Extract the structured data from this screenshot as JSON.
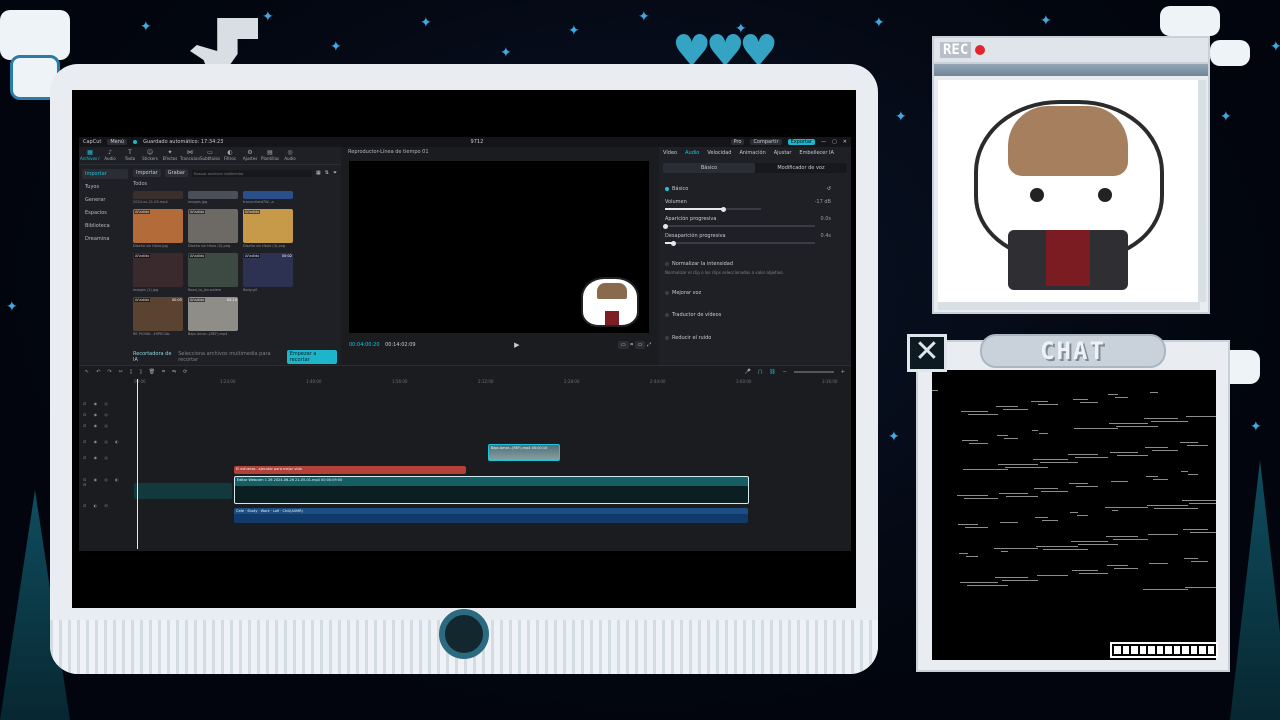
{
  "app": {
    "brand": "CapCut",
    "menu": "Menú",
    "project_name": "Guardado automático: 17:34:23",
    "resolution": "9712",
    "pro_label": "Pro",
    "share_label": "Compartir",
    "export_label": "Exportar"
  },
  "media": {
    "categories": [
      {
        "icon": "▦",
        "label": "Archivos multimedia",
        "icon_name": "media-icon"
      },
      {
        "icon": "♪",
        "label": "Audio",
        "icon_name": "music-icon"
      },
      {
        "icon": "T",
        "label": "Texto",
        "icon_name": "text-icon"
      },
      {
        "icon": "☺",
        "label": "Stickers",
        "icon_name": "sticker-icon"
      },
      {
        "icon": "✦",
        "label": "Efectos",
        "icon_name": "effects-icon"
      },
      {
        "icon": "⋈",
        "label": "Transiciones",
        "icon_name": "transition-icon"
      },
      {
        "icon": "▭",
        "label": "Subtítulos",
        "icon_name": "subtitle-icon"
      },
      {
        "icon": "◐",
        "label": "Filtros",
        "icon_name": "filter-icon"
      },
      {
        "icon": "⚙",
        "label": "Ajustes",
        "icon_name": "adjust-icon"
      },
      {
        "icon": "▤",
        "label": "Plantillas",
        "icon_name": "template-icon"
      },
      {
        "icon": "◎",
        "label": "Audio",
        "icon_name": "audio-ai-icon"
      }
    ],
    "sidebar": [
      "Importar",
      "Tuyos",
      "Generar",
      "Espacios",
      "Biblioteca",
      "Dreamina"
    ],
    "import_label": "Importar",
    "record_label": "Grabar",
    "search_placeholder": "Buscar archivos multimedia",
    "all_label": "Todos",
    "items": [
      {
        "label": "",
        "duration": "",
        "caption": "2024-xx-21-05.mp4",
        "color": "#3b2f2b"
      },
      {
        "label": "",
        "duration": "",
        "caption": "images.jpg",
        "color": "#4a4f58"
      },
      {
        "label": "",
        "duration": "",
        "caption": "transcribed7W...a",
        "color": "#2b4f8a"
      },
      {
        "label": "Añadido",
        "duration": "",
        "caption": "Diseño sin título.jpg",
        "color": "#b36b3a"
      },
      {
        "label": "Añadido",
        "duration": "",
        "caption": "Diseño sin título (2).png",
        "color": "#6d6a66"
      },
      {
        "label": "Añadido",
        "duration": "",
        "caption": "Diseño sin título (3).png",
        "color": "#c79a4a"
      },
      {
        "label": "Añadido",
        "duration": "",
        "caption": "images (1).jpg",
        "color": "#3a2a2e"
      },
      {
        "label": "Añadido",
        "duration": "",
        "caption": "Road_to_Jerusalem",
        "color": "#3d4a43"
      },
      {
        "label": "Añadido",
        "duration": "00:02",
        "caption": "Body.gif",
        "color": "#2d3152"
      },
      {
        "label": "Añadido",
        "duration": "00:05",
        "caption": "RE PICNIK...ESPECIAL",
        "color": "#5a4330"
      },
      {
        "label": "Añadido",
        "duration": "00:10",
        "caption": "Bajo Amor...(REF).mp4",
        "color": "#8f8d88"
      }
    ],
    "promo_title": "Recortadora de IA",
    "promo_text": "Selecciona archivos multimedia para recortar",
    "promo_button": "Empezar a recortar"
  },
  "player": {
    "title": "Reproductor-Línea de tiempo 01",
    "timecode": "00:04:00:20",
    "duration": "00:14:02:09",
    "play_icon": "play-icon"
  },
  "props": {
    "tabs": [
      "Vídeo",
      "Audio",
      "Velocidad",
      "Animación",
      "Ajustar",
      "Embellecer IA"
    ],
    "active_tab": "Audio",
    "subtabs": [
      "Básico",
      "Modificador de voz"
    ],
    "section_title": "Básico",
    "volume_label": "Volumen",
    "volume_value": "-17 dB",
    "fadein_label": "Aparición progresiva",
    "fadein_value": "0.0s",
    "fadeout_label": "Desaparición progresiva",
    "fadeout_value": "0.4s",
    "normalize_label": "Normalizar la intensidad",
    "normalize_note": "Normalizar el clip o los clips seleccionados a valor objetivo.",
    "enhance_label": "Mejorar voz",
    "translate_label": "Traductor de vídeos",
    "noise_label": "Reducir el ruido",
    "volume_level": 0.6,
    "fadein_level": 0.0,
    "fadeout_level": 0.05
  },
  "timeline": {
    "ruler": [
      "00:00",
      "1:24:00",
      "1:40:00",
      "1:56:00",
      "2:12:00",
      "2:28:00",
      "2:44:00",
      "3:00:00",
      "3:16:00"
    ],
    "clips": [
      {
        "label": "Bajo Amor...(REF).mp4  00:00:10",
        "kind": "image"
      },
      {
        "label": "El esfuerzo...ejecutar para mejor vida",
        "kind": "text"
      },
      {
        "label": "Editar  Webcam 1 26  2024-06-26 21-05-01.mp4  00:00:09:00",
        "kind": "video"
      },
      {
        "label": "Cafe · Study · Work · Lofi · Chill(ASMR)",
        "kind": "audio"
      }
    ]
  },
  "overlay": {
    "rec_label": "REC",
    "chat_title": "CHAT",
    "close_label": "✕"
  }
}
